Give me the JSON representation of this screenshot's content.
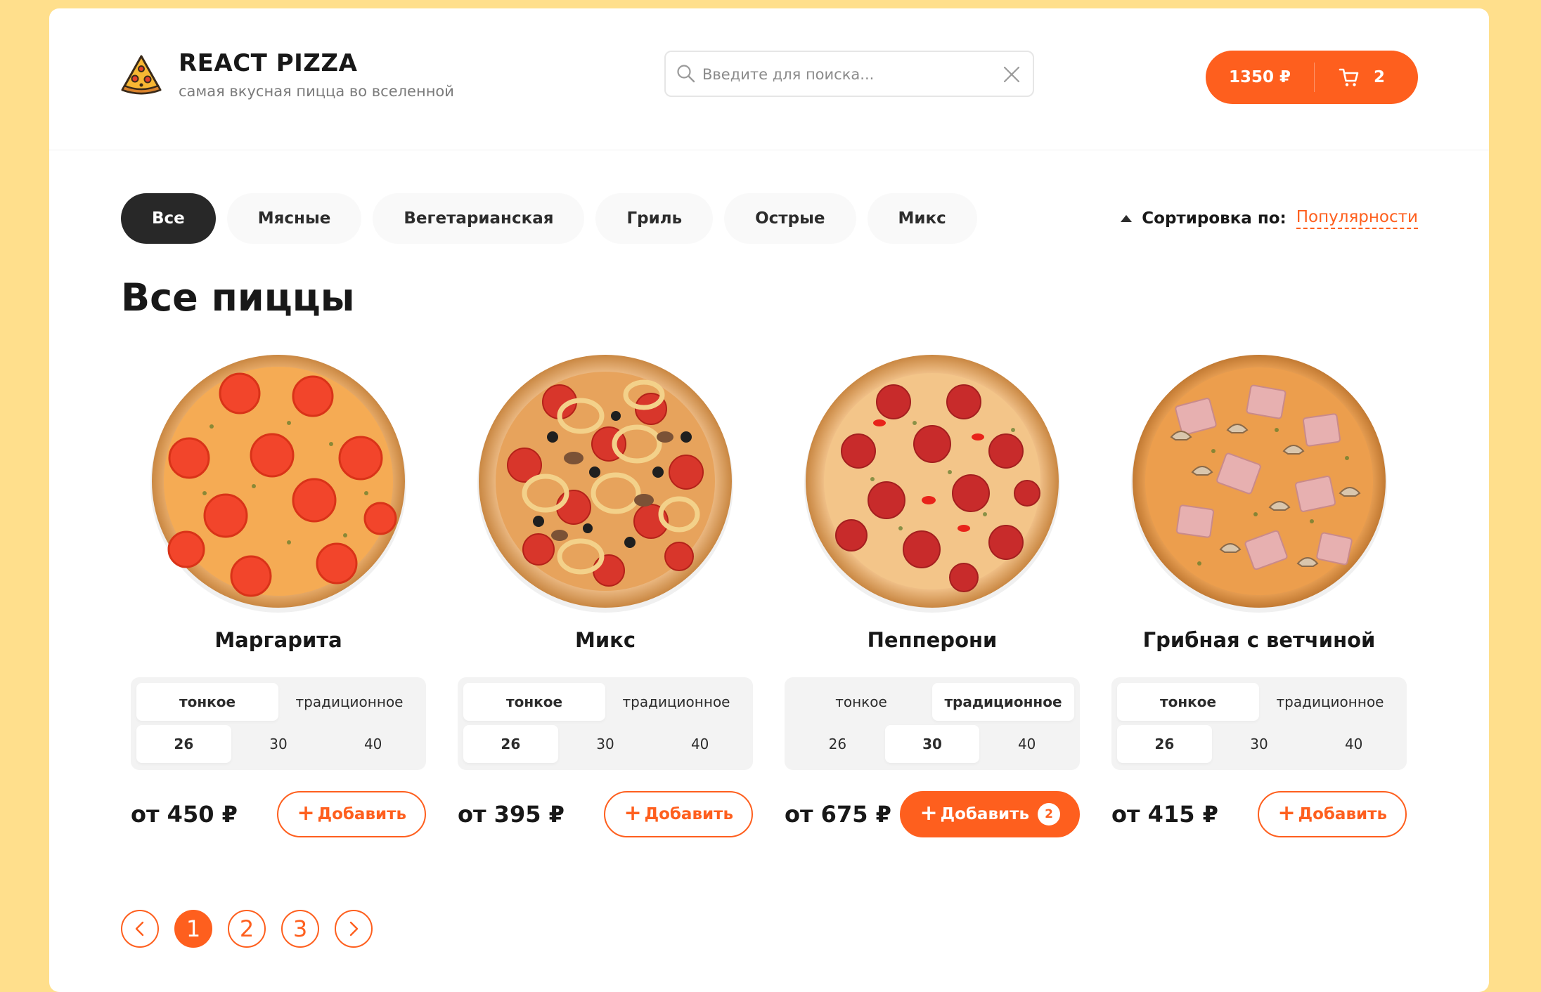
{
  "header": {
    "brand": "REACT PIZZA",
    "tagline": "самая вкусная пицца во вселенной",
    "search_placeholder": "Введите для поиска...",
    "cart_total": "1350 ₽",
    "cart_count": "2"
  },
  "categories": [
    {
      "label": "Все",
      "active": true
    },
    {
      "label": "Мясные",
      "active": false
    },
    {
      "label": "Вегетарианская",
      "active": false
    },
    {
      "label": "Гриль",
      "active": false
    },
    {
      "label": "Острые",
      "active": false
    },
    {
      "label": "Микс",
      "active": false
    }
  ],
  "sort": {
    "label": "Сортировка по:",
    "value": "Популярности"
  },
  "page_title": "Все пиццы",
  "pizzas": [
    {
      "name": "Маргарита",
      "types": [
        "тонкое",
        "традиционное"
      ],
      "active_type": 0,
      "sizes": [
        "26",
        "30",
        "40"
      ],
      "active_size": 0,
      "price": "от 450 ₽",
      "add_label": "Добавить",
      "count": null,
      "topping": "tomato"
    },
    {
      "name": "Микс",
      "types": [
        "тонкое",
        "традиционное"
      ],
      "active_type": 0,
      "sizes": [
        "26",
        "30",
        "40"
      ],
      "active_size": 0,
      "price": "от 395 ₽",
      "add_label": "Добавить",
      "count": null,
      "topping": "mix"
    },
    {
      "name": "Пепперони",
      "types": [
        "тонкое",
        "традиционное"
      ],
      "active_type": 1,
      "sizes": [
        "26",
        "30",
        "40"
      ],
      "active_size": 1,
      "price": "от 675 ₽",
      "add_label": "Добавить",
      "count": "2",
      "topping": "pepperoni"
    },
    {
      "name": "Грибная с ветчиной",
      "types": [
        "тонкое",
        "традиционное"
      ],
      "active_type": 0,
      "sizes": [
        "26",
        "30",
        "40"
      ],
      "active_size": 0,
      "price": "от 415 ₽",
      "add_label": "Добавить",
      "count": null,
      "topping": "ham-mushroom"
    }
  ],
  "pagination": {
    "pages": [
      "1",
      "2",
      "3"
    ],
    "active": 0
  },
  "colors": {
    "accent": "#fe5f1e",
    "dark": "#282828",
    "background": "#ffdf8c"
  },
  "icons": {
    "logo": "pizza-slice-icon",
    "search": "search-icon",
    "clear": "close-icon",
    "cart": "cart-icon",
    "sort": "caret-up-icon",
    "prev": "chevron-left-icon",
    "next": "chevron-right-icon"
  }
}
